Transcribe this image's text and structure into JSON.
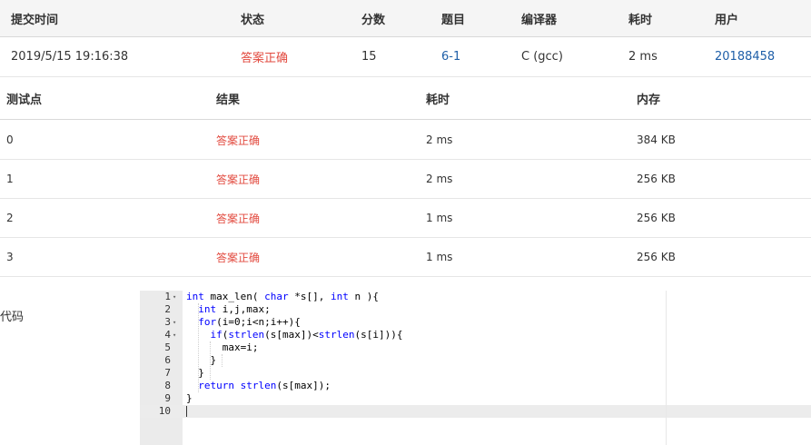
{
  "submission": {
    "headers": [
      "提交时间",
      "状态",
      "分数",
      "题目",
      "编译器",
      "耗时",
      "用户"
    ],
    "row": {
      "time": "2019/5/15 19:16:38",
      "status": "答案正确",
      "score": "15",
      "problem": "6-1",
      "compiler": "C (gcc)",
      "duration": "2 ms",
      "user": "20188458"
    }
  },
  "testcases": {
    "headers": [
      "测试点",
      "结果",
      "耗时",
      "内存"
    ],
    "rows": [
      {
        "id": "0",
        "result": "答案正确",
        "time": "2 ms",
        "memory": "384 KB"
      },
      {
        "id": "1",
        "result": "答案正确",
        "time": "2 ms",
        "memory": "256 KB"
      },
      {
        "id": "2",
        "result": "答案正确",
        "time": "1 ms",
        "memory": "256 KB"
      },
      {
        "id": "3",
        "result": "答案正确",
        "time": "1 ms",
        "memory": "256 KB"
      }
    ]
  },
  "code": {
    "label": "代码",
    "lines": [
      {
        "n": "1",
        "fold": true,
        "tokens": [
          [
            "kw",
            "int"
          ],
          [
            "t",
            " max_len( "
          ],
          [
            "kw",
            "char"
          ],
          [
            "t",
            " *s[], "
          ],
          [
            "kw",
            "int"
          ],
          [
            "t",
            " n ){"
          ]
        ]
      },
      {
        "n": "2",
        "fold": false,
        "tokens": [
          [
            "t",
            "  "
          ],
          [
            "kw",
            "int"
          ],
          [
            "t",
            " i,j,max;"
          ]
        ]
      },
      {
        "n": "3",
        "fold": true,
        "tokens": [
          [
            "t",
            "  "
          ],
          [
            "kw",
            "for"
          ],
          [
            "t",
            "(i=0;i<n;i++){"
          ]
        ]
      },
      {
        "n": "4",
        "fold": true,
        "tokens": [
          [
            "t",
            "    "
          ],
          [
            "kw",
            "if"
          ],
          [
            "t",
            "("
          ],
          [
            "kw",
            "strlen"
          ],
          [
            "t",
            "(s[max])<"
          ],
          [
            "kw",
            "strlen"
          ],
          [
            "t",
            "(s[i])){"
          ]
        ]
      },
      {
        "n": "5",
        "fold": false,
        "tokens": [
          [
            "t",
            "      max=i;"
          ]
        ]
      },
      {
        "n": "6",
        "fold": false,
        "tokens": [
          [
            "t",
            "    }"
          ]
        ]
      },
      {
        "n": "7",
        "fold": false,
        "tokens": [
          [
            "t",
            "  }"
          ]
        ]
      },
      {
        "n": "8",
        "fold": false,
        "tokens": [
          [
            "t",
            "  "
          ],
          [
            "kw",
            "return"
          ],
          [
            "t",
            " "
          ],
          [
            "kw",
            "strlen"
          ],
          [
            "t",
            "(s[max]);"
          ]
        ]
      },
      {
        "n": "9",
        "fold": false,
        "tokens": [
          [
            "t",
            "}"
          ]
        ]
      },
      {
        "n": "10",
        "fold": false,
        "tokens": []
      }
    ]
  },
  "colors": {
    "accepted": "#e24a3f",
    "link": "#1f5fa8",
    "keyword": "#0000ff"
  }
}
